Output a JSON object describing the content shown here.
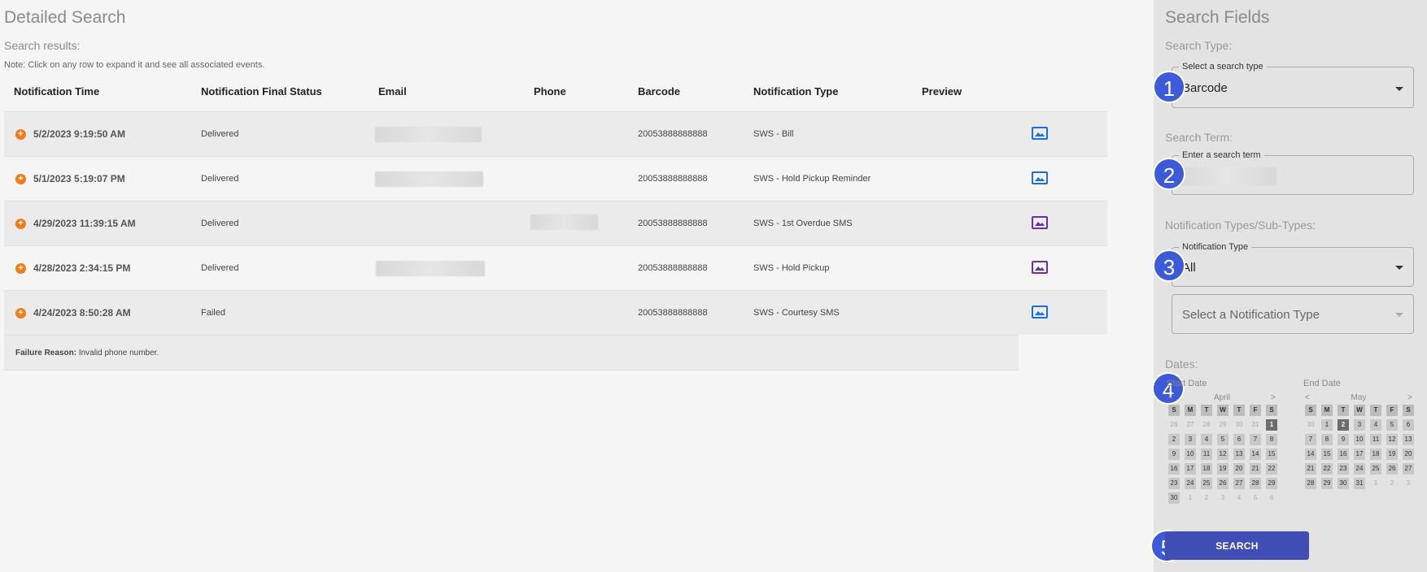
{
  "main": {
    "title": "Detailed Search",
    "results_label": "Search results:",
    "note": "Note: Click on any row to expand it and see all associated events."
  },
  "table": {
    "headers": [
      "Notification Time",
      "Notification Final Status",
      "Email",
      "Phone",
      "Barcode",
      "Notification Type",
      "Preview"
    ],
    "rows": [
      {
        "time": "5/2/2023 9:19:50 AM",
        "status": "Delivered",
        "barcode": "20053888888888",
        "type": "SWS - Bill",
        "preview_color": "#1e6fd8"
      },
      {
        "time": "5/1/2023 5:19:07 PM",
        "status": "Delivered",
        "barcode": "20053888888888",
        "type": "SWS - Hold Pickup Reminder",
        "preview_color": "#1e6fd8"
      },
      {
        "time": "4/29/2023 11:39:15 AM",
        "status": "Delivered",
        "barcode": "20053888888888",
        "type": "SWS - 1st Overdue SMS",
        "preview_color": "#6a2fa0"
      },
      {
        "time": "4/28/2023 2:34:15 PM",
        "status": "Delivered",
        "barcode": "20053888888888",
        "type": "SWS - Hold Pickup",
        "preview_color": "#6a2fa0"
      },
      {
        "time": "4/24/2023 8:50:28 AM",
        "status": "Failed",
        "barcode": "20053888888888",
        "type": "SWS - Courtesy SMS",
        "preview_color": "#1e6fd8"
      }
    ],
    "failure": {
      "label": "Failure Reason:",
      "text": "Invalid phone number."
    }
  },
  "sidebar": {
    "title": "Search Fields",
    "search_type_label": "Search Type:",
    "search_type_legend": "Select a search type",
    "search_type_value": "Barcode",
    "search_term_label": "Search Term:",
    "search_term_legend": "Enter a search term",
    "notif_label": "Notification Types/Sub-Types:",
    "notif_legend": "Notification Type",
    "notif_value": "All",
    "subtype_placeholder": "Select a Notification Type",
    "dates_label": "Dates:",
    "search_button": "SEARCH",
    "badges": [
      "1",
      "2",
      "3",
      "4",
      "5"
    ]
  },
  "calendars": {
    "weekdays": [
      "S",
      "M",
      "T",
      "W",
      "T",
      "F",
      "S"
    ],
    "prev": "<",
    "next": ">",
    "start": {
      "title": "Start Date",
      "month": "April",
      "lead": [
        "26",
        "27",
        "28",
        "29",
        "30",
        "31"
      ],
      "days": [
        "1",
        "2",
        "3",
        "4",
        "5",
        "6",
        "7",
        "8",
        "9",
        "10",
        "11",
        "12",
        "13",
        "14",
        "15",
        "16",
        "17",
        "18",
        "19",
        "20",
        "21",
        "22",
        "23",
        "24",
        "25",
        "26",
        "27",
        "28",
        "29",
        "30"
      ],
      "trail": [
        "1",
        "2",
        "3",
        "4",
        "5",
        "6"
      ],
      "selected": "1"
    },
    "end": {
      "title": "End Date",
      "month": "May",
      "lead": [
        "30"
      ],
      "days": [
        "1",
        "2",
        "3",
        "4",
        "5",
        "6",
        "7",
        "8",
        "9",
        "10",
        "11",
        "12",
        "13",
        "14",
        "15",
        "16",
        "17",
        "18",
        "19",
        "20",
        "21",
        "22",
        "23",
        "24",
        "25",
        "26",
        "27",
        "28",
        "29",
        "30",
        "31"
      ],
      "trail": [
        "1",
        "2",
        "3"
      ],
      "selected": "2"
    }
  }
}
